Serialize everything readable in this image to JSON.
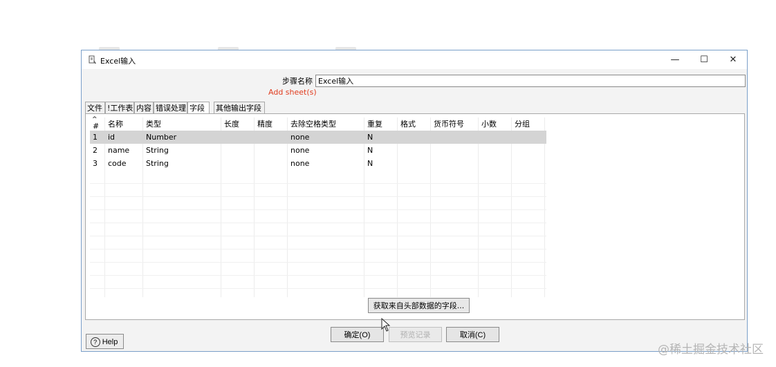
{
  "window": {
    "title": "Excel输入",
    "buttons": {
      "minimize": "—",
      "maximize": "☐",
      "close": "✕"
    }
  },
  "form": {
    "step_name_label": "步骤名称",
    "step_name_value": "Excel输入",
    "add_sheet_warning": "Add sheet(s)"
  },
  "tabs": [
    {
      "label": "文件",
      "active": false
    },
    {
      "label": "!工作表",
      "active": false
    },
    {
      "label": "内容",
      "active": false
    },
    {
      "label": "错误处理",
      "active": false
    },
    {
      "label": "字段",
      "active": true
    },
    {
      "label": "其他输出字段",
      "active": false
    }
  ],
  "table": {
    "sort_indicator": "^",
    "columns": [
      "#",
      "名称",
      "类型",
      "长度",
      "精度",
      "去除空格类型",
      "重复",
      "格式",
      "货币符号",
      "小数",
      "分组"
    ],
    "rows": [
      [
        "1",
        "id",
        "Number",
        "",
        "",
        "none",
        "N",
        "",
        "",
        "",
        ""
      ],
      [
        "2",
        "name",
        "String",
        "",
        "",
        "none",
        "N",
        "",
        "",
        "",
        ""
      ],
      [
        "3",
        "code",
        "String",
        "",
        "",
        "none",
        "N",
        "",
        "",
        "",
        ""
      ]
    ],
    "selected_row": 0
  },
  "fetch_button": "获取来自头部数据的字段...",
  "help_button": "Help",
  "dialog_buttons": {
    "ok": "确定(O)",
    "preview": "预览记录",
    "cancel": "取消(C)"
  },
  "watermark": "@稀土掘金技术社区",
  "colors": {
    "warning": "#e03c1f",
    "selected_row": "#d4d4d4",
    "window_border": "#7a9fc9"
  }
}
